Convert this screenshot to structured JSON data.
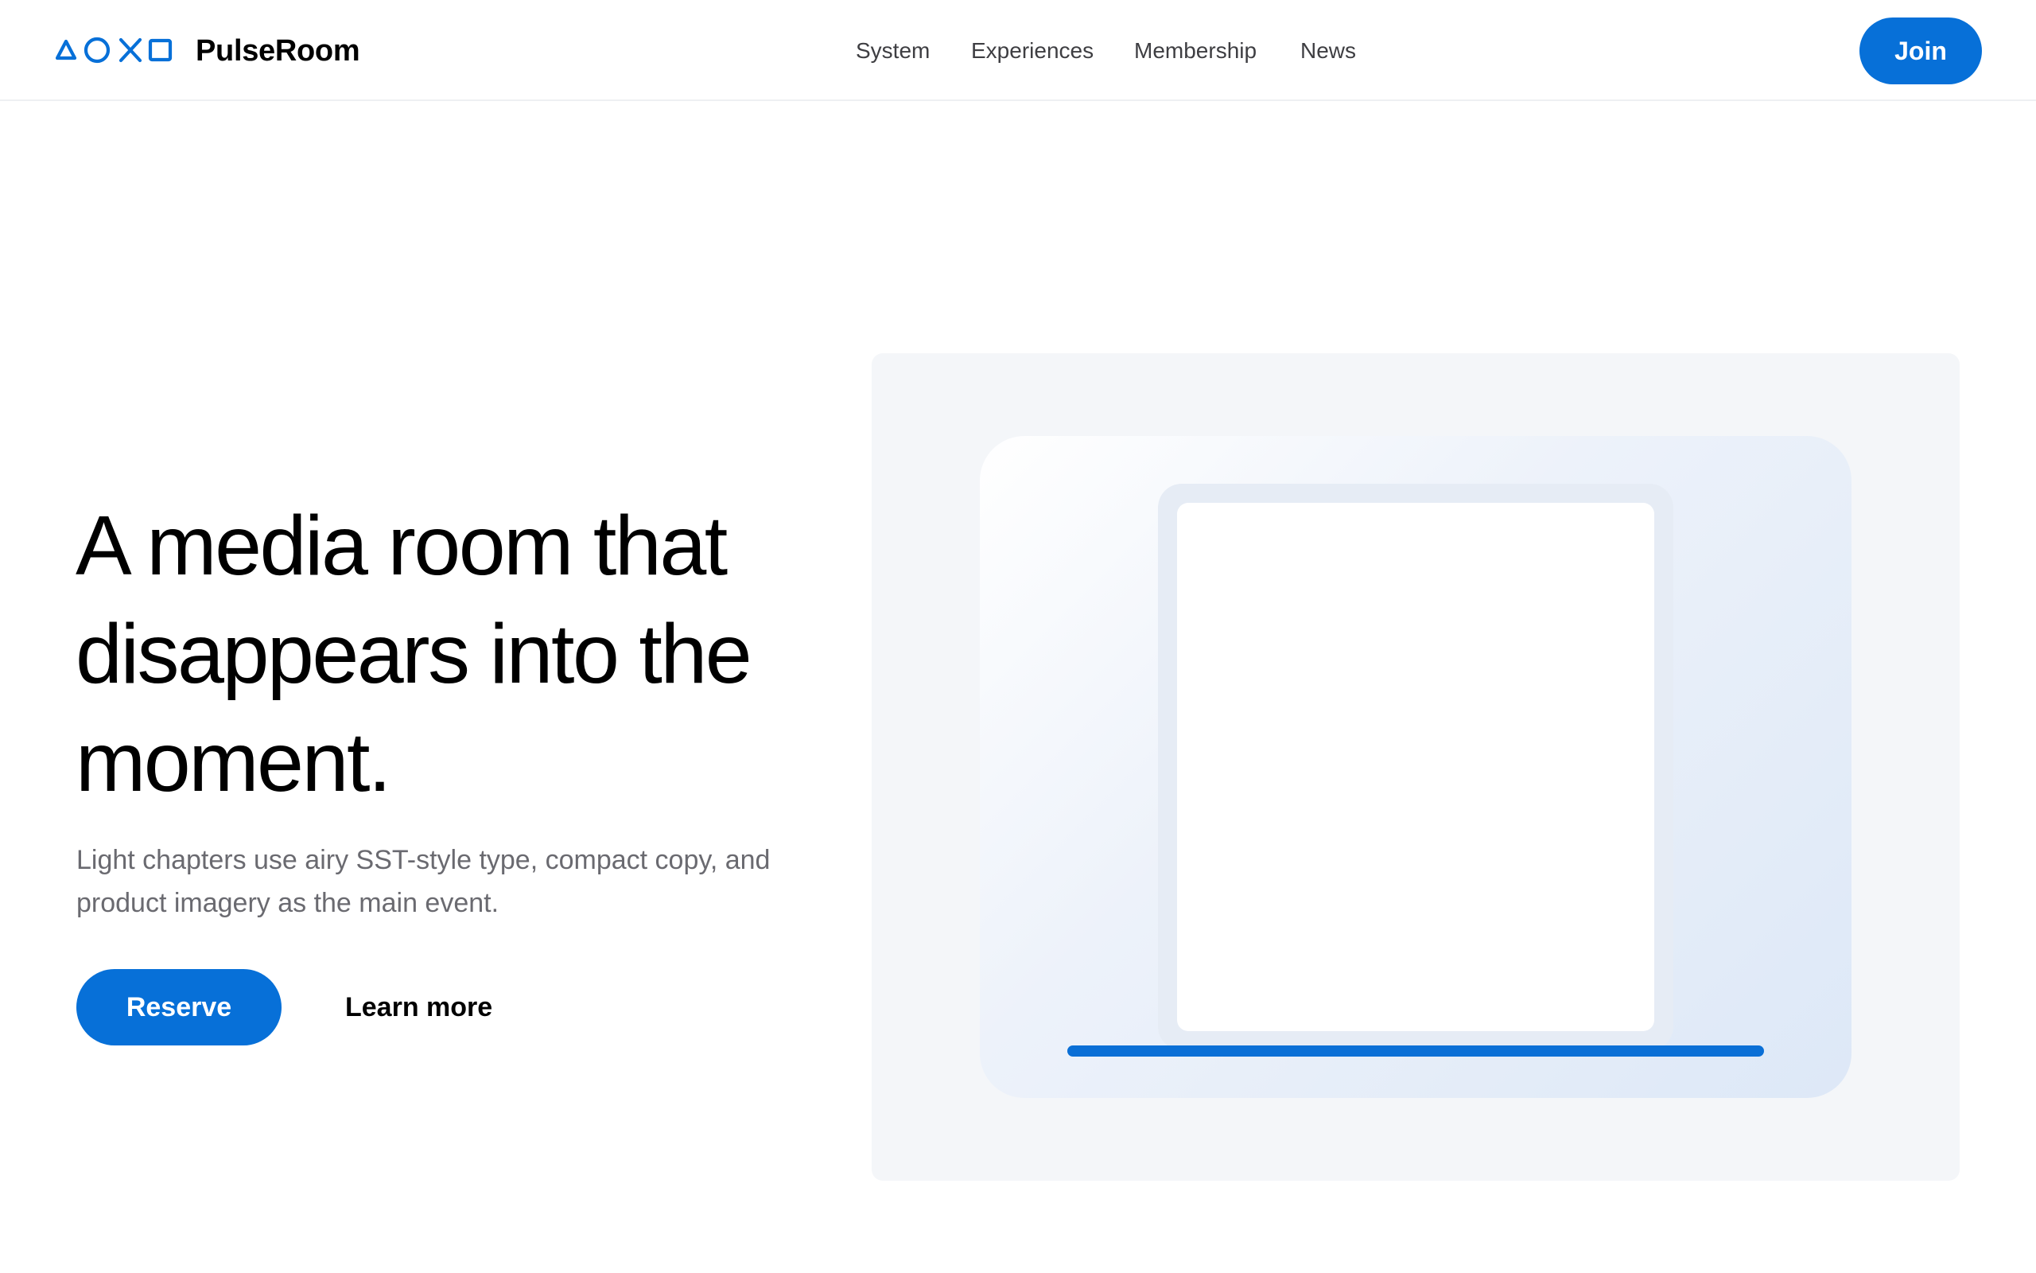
{
  "header": {
    "brand": "PulseRoom",
    "logo_icons": [
      "triangle-icon",
      "circle-icon",
      "cross-icon",
      "square-icon"
    ],
    "nav": [
      "System",
      "Experiences",
      "Membership",
      "News"
    ],
    "join_label": "Join"
  },
  "hero": {
    "headline": "A media room that disappears into the moment.",
    "subcopy": "Light chapters use airy SST-style type, compact copy, and product imagery as the main event.",
    "primary_cta": "Reserve",
    "secondary_cta": "Learn more"
  },
  "colors": {
    "accent": "#0770d8",
    "panel_bg": "#f4f6f9",
    "text_muted": "#6a6a70"
  }
}
